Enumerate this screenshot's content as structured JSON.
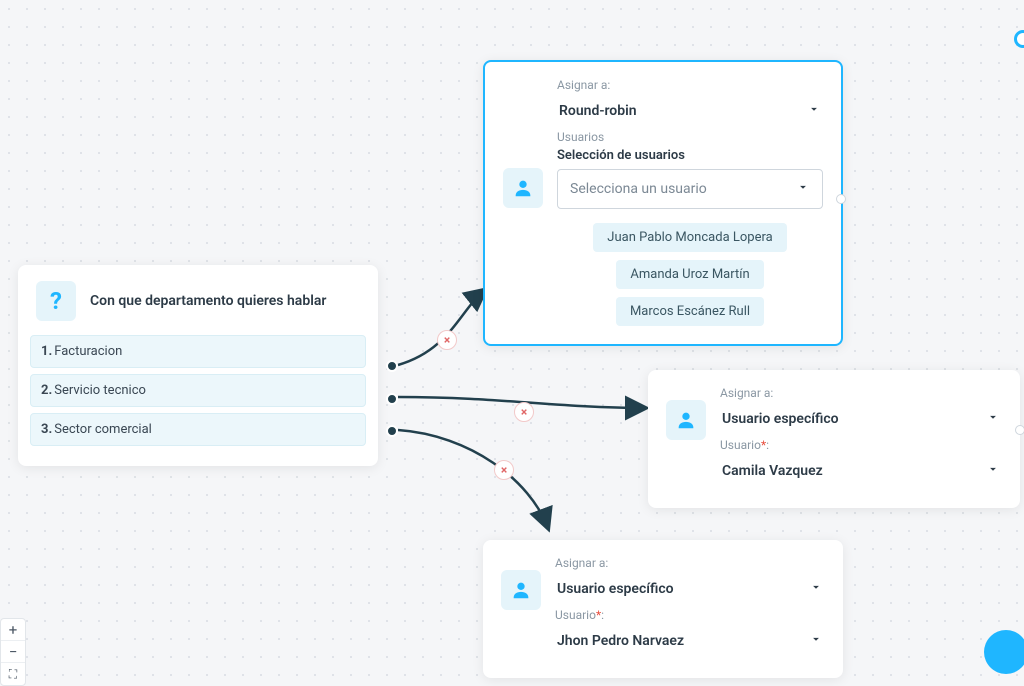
{
  "question": {
    "title": "Con que departamento quieres hablar",
    "options": [
      {
        "num": "1.",
        "label": "Facturacion"
      },
      {
        "num": "2.",
        "label": "Servicio tecnico"
      },
      {
        "num": "3.",
        "label": "Sector comercial"
      }
    ]
  },
  "assign1": {
    "assign_label": "Asignar a:",
    "assign_value": "Round-robin",
    "users_label": "Usuarios",
    "users_sublabel": "Selección de usuarios",
    "dropdown_placeholder": "Selecciona un usuario",
    "selected_users": [
      "Juan Pablo Moncada Lopera",
      "Amanda Uroz Martín",
      "Marcos Escánez Rull"
    ]
  },
  "assign2": {
    "assign_label": "Asignar a:",
    "assign_value": "Usuario específico",
    "user_label": "Usuario",
    "user_value": "Camila Vazquez"
  },
  "assign3": {
    "assign_label": "Asignar a:",
    "assign_value": "Usuario específico",
    "user_label": "Usuario",
    "user_value": "Jhon Pedro Narvaez"
  },
  "zoom": {
    "plus": "+",
    "minus": "−",
    "fit": "⛶"
  },
  "remove": "×"
}
